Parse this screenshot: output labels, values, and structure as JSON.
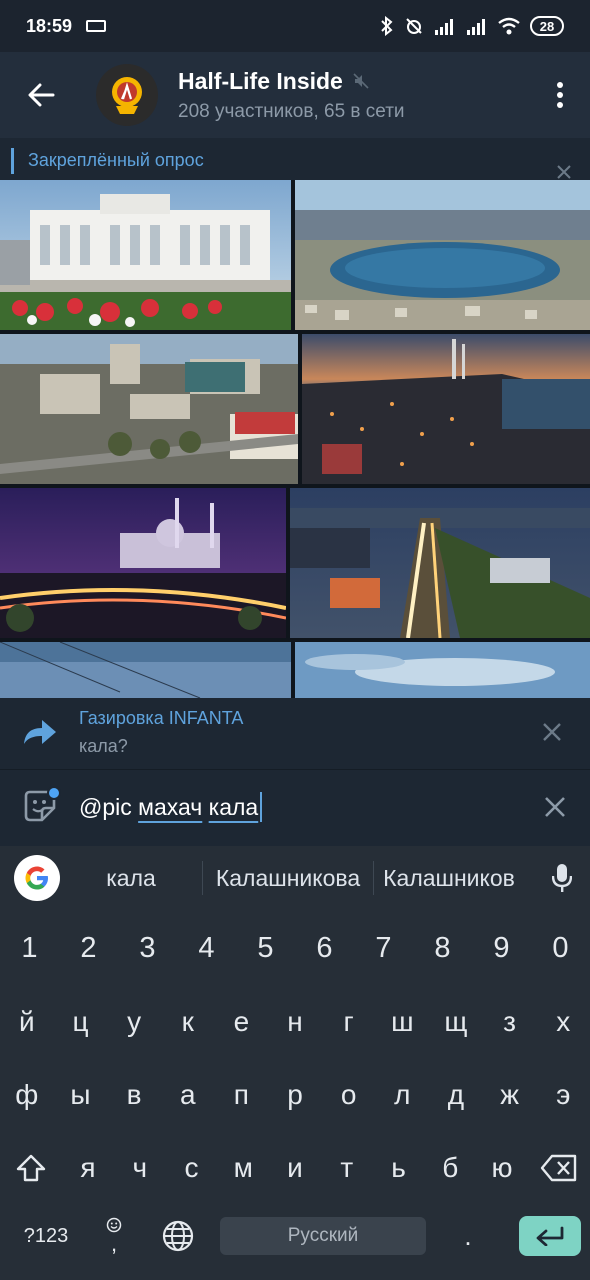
{
  "status": {
    "time": "18:59",
    "battery": "28"
  },
  "header": {
    "title": "Half-Life Inside",
    "subtitle": "208 участников, 65 в сети",
    "avatar_icon": "lambda-logo-icon"
  },
  "pinned": {
    "label": "Закреплённый опрос"
  },
  "photos": [
    {
      "name": "photo-government-building",
      "colors": [
        "#8fb4d6",
        "#f2f2f2",
        "#c83a3a"
      ]
    },
    {
      "name": "photo-city-lake-aerial",
      "colors": [
        "#9fc3df",
        "#2d6f98",
        "#8a8f7a"
      ]
    },
    {
      "name": "photo-city-street-aerial",
      "colors": [
        "#8fa8bf",
        "#7b7b70",
        "#4a4a40"
      ]
    },
    {
      "name": "photo-coastal-city-dusk",
      "colors": [
        "#2a3a55",
        "#a8643a",
        "#1a1f2a"
      ]
    },
    {
      "name": "photo-mosque-night",
      "colors": [
        "#3a2a6b",
        "#d07a3a",
        "#1a1530"
      ]
    },
    {
      "name": "photo-avenue-night-traffic",
      "colors": [
        "#2b3c5a",
        "#e9c27a",
        "#2a3520"
      ]
    },
    {
      "name": "photo-city-panorama-blue",
      "colors": [
        "#6b8fb8",
        "#4a6e95"
      ]
    },
    {
      "name": "photo-sky-clouds",
      "colors": [
        "#7fa6c9",
        "#c7d8e6"
      ]
    }
  ],
  "reply": {
    "name": "Газировка INFANTA",
    "text": "кала?"
  },
  "input": {
    "prefix": "@pic ",
    "word1": "махач",
    "space": " ",
    "word2": "кала"
  },
  "suggestions": [
    "кала",
    "Калашникова",
    "Калашников"
  ],
  "keyboard": {
    "numbers": [
      "1",
      "2",
      "3",
      "4",
      "5",
      "6",
      "7",
      "8",
      "9",
      "0"
    ],
    "row1": [
      "й",
      "ц",
      "у",
      "к",
      "е",
      "н",
      "г",
      "ш",
      "щ",
      "з",
      "х"
    ],
    "row2": [
      "ф",
      "ы",
      "в",
      "а",
      "п",
      "р",
      "о",
      "л",
      "д",
      "ж",
      "э"
    ],
    "row3": [
      "я",
      "ч",
      "с",
      "м",
      "и",
      "т",
      "ь",
      "б",
      "ю"
    ],
    "symbols_label": "?123",
    "comma": ",",
    "space_label": "Русский",
    "period": "."
  }
}
